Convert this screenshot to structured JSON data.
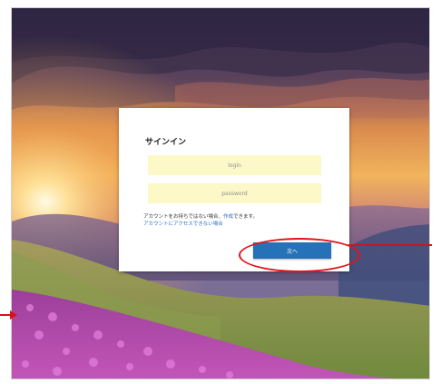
{
  "signin": {
    "title": "サインイン",
    "login_placeholder": "login",
    "password_placeholder": "password",
    "no_account_text": "アカウントをお持ちではない場合、",
    "create_link": "作成",
    "create_suffix": "できます。",
    "cannot_access_link": "アカウントにアクセスできない場合",
    "next_button": "次へ"
  },
  "colors": {
    "accent": "#2572b8",
    "field_bg": "#fdf8c7",
    "annotation": "#e1141a"
  }
}
